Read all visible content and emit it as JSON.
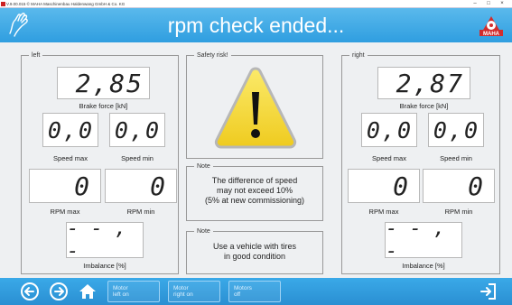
{
  "window": {
    "title": "V.9.00.015 © MAHA Maschinenbau Haldenwang GmbH & Co. KG",
    "controls": [
      "–",
      "□",
      "×"
    ]
  },
  "header": {
    "title": "rpm check ended...",
    "logo_text": "MAHA"
  },
  "left": {
    "legend": "left",
    "brake_force": {
      "value": "2,85",
      "label": "Brake force [kN]"
    },
    "speed_max": {
      "value": "0,0",
      "label": "Speed max"
    },
    "speed_min": {
      "value": "0,0",
      "label": "Speed min"
    },
    "rpm_max": {
      "value": "0",
      "label": "RPM max"
    },
    "rpm_min": {
      "value": "0",
      "label": "RPM min"
    },
    "imbalance": {
      "value": "- - , -",
      "label": "Imbalance [%]"
    }
  },
  "right": {
    "legend": "right",
    "brake_force": {
      "value": "2,87",
      "label": "Brake force [kN]"
    },
    "speed_max": {
      "value": "0,0",
      "label": "Speed max"
    },
    "speed_min": {
      "value": "0,0",
      "label": "Speed min"
    },
    "rpm_max": {
      "value": "0",
      "label": "RPM max"
    },
    "rpm_min": {
      "value": "0",
      "label": "RPM min"
    },
    "imbalance": {
      "value": "- - , -",
      "label": "Imbalance [%]"
    }
  },
  "safety": {
    "legend": "Safety risk!"
  },
  "note1": {
    "legend": "Note",
    "lines": [
      "The difference of speed",
      "may not exceed 10%",
      "(5% at new commissioning)"
    ]
  },
  "note2": {
    "legend": "Note",
    "lines": [
      "Use a vehicle with tires",
      "in good condition"
    ]
  },
  "toolbar": {
    "motor_left": [
      "Motor",
      "left on"
    ],
    "motor_right": [
      "Motor",
      "right on"
    ],
    "motors_off": [
      "Motors",
      "off"
    ]
  },
  "colors": {
    "header": "#3aa8e8",
    "bottom_bar": "#2a8fd2",
    "warning_yellow": "#f5dc3c",
    "logo_red": "#d22d2d"
  }
}
